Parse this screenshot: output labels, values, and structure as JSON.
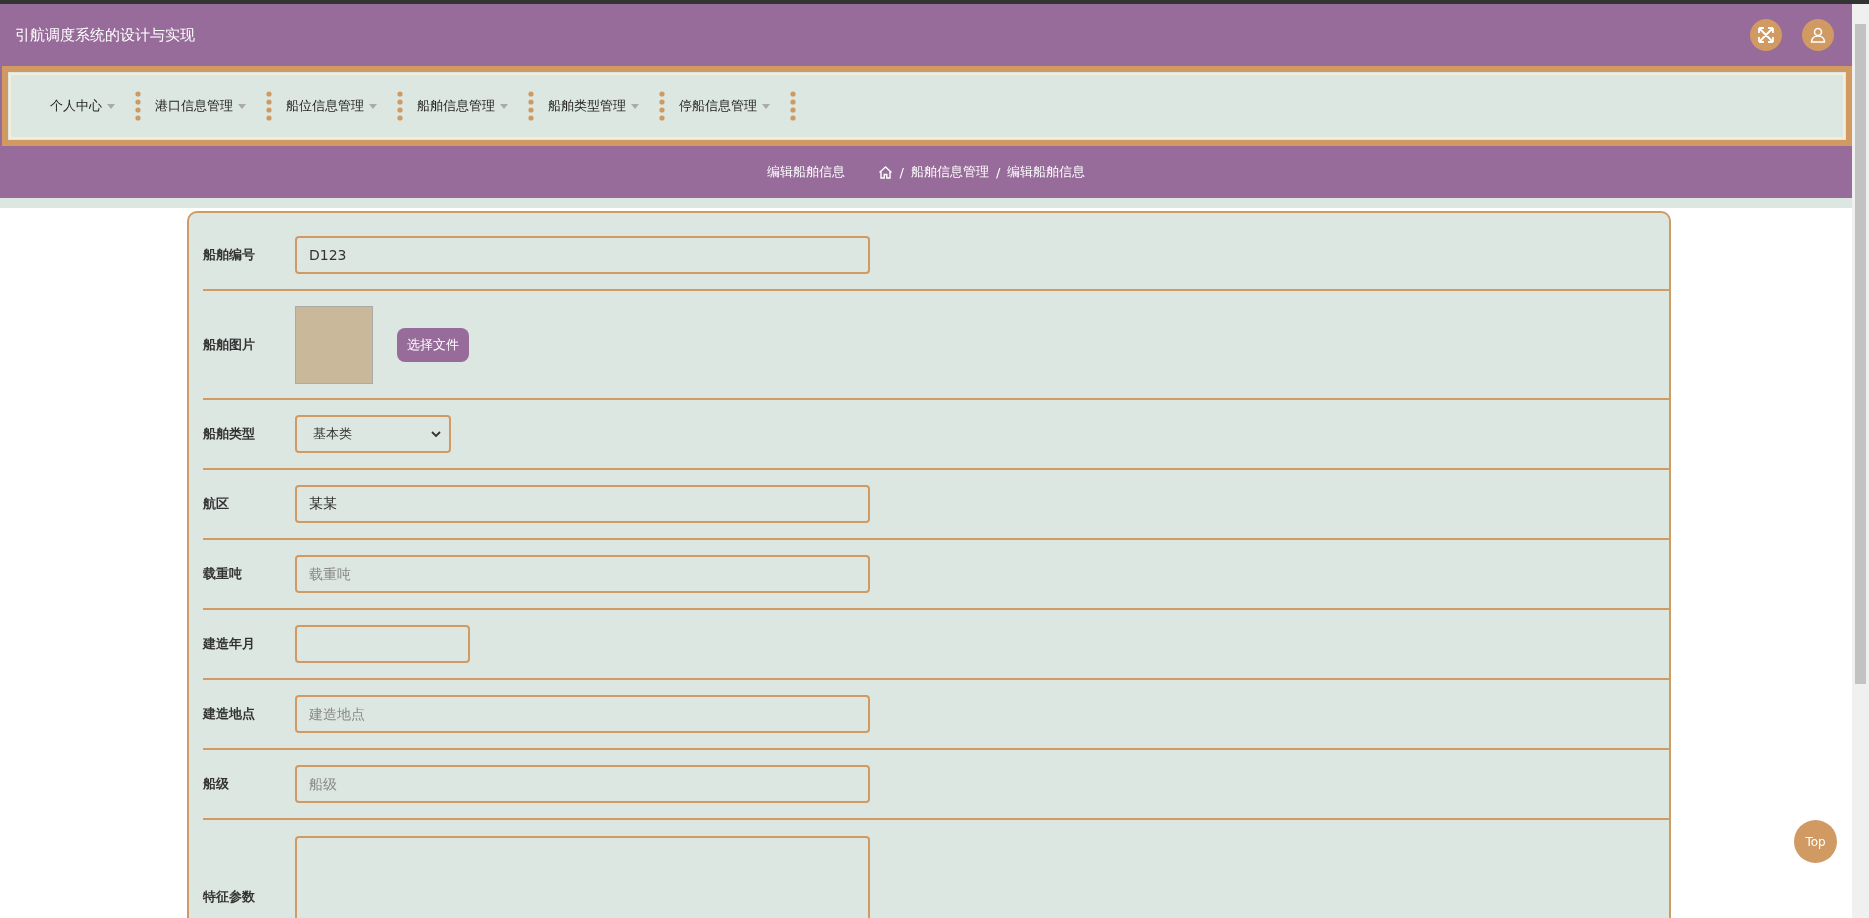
{
  "header": {
    "title": "引航调度系统的设计与实现"
  },
  "nav": {
    "items": [
      {
        "label": "个人中心"
      },
      {
        "label": "港口信息管理"
      },
      {
        "label": "船位信息管理"
      },
      {
        "label": "船舶信息管理"
      },
      {
        "label": "船舶类型管理"
      },
      {
        "label": "停船信息管理"
      }
    ]
  },
  "breadcrumb": {
    "title": "编辑船舶信息",
    "path": [
      "船舶信息管理",
      "编辑船舶信息"
    ],
    "separator": "/"
  },
  "form": {
    "fields": [
      {
        "kind": "text",
        "label": "船舶编号",
        "value": "D123"
      },
      {
        "kind": "image",
        "label": "船舶图片",
        "button": "选择文件"
      },
      {
        "kind": "select",
        "label": "船舶类型",
        "value": "基本类"
      },
      {
        "kind": "text",
        "label": "航区",
        "value": "某某"
      },
      {
        "kind": "text",
        "label": "载重吨",
        "placeholder": "载重吨"
      },
      {
        "kind": "date",
        "label": "建造年月"
      },
      {
        "kind": "text",
        "label": "建造地点",
        "placeholder": "建造地点"
      },
      {
        "kind": "text",
        "label": "船级",
        "placeholder": "船级"
      },
      {
        "kind": "textarea",
        "label": "特征参数"
      }
    ]
  },
  "back_to_top": "Top"
}
